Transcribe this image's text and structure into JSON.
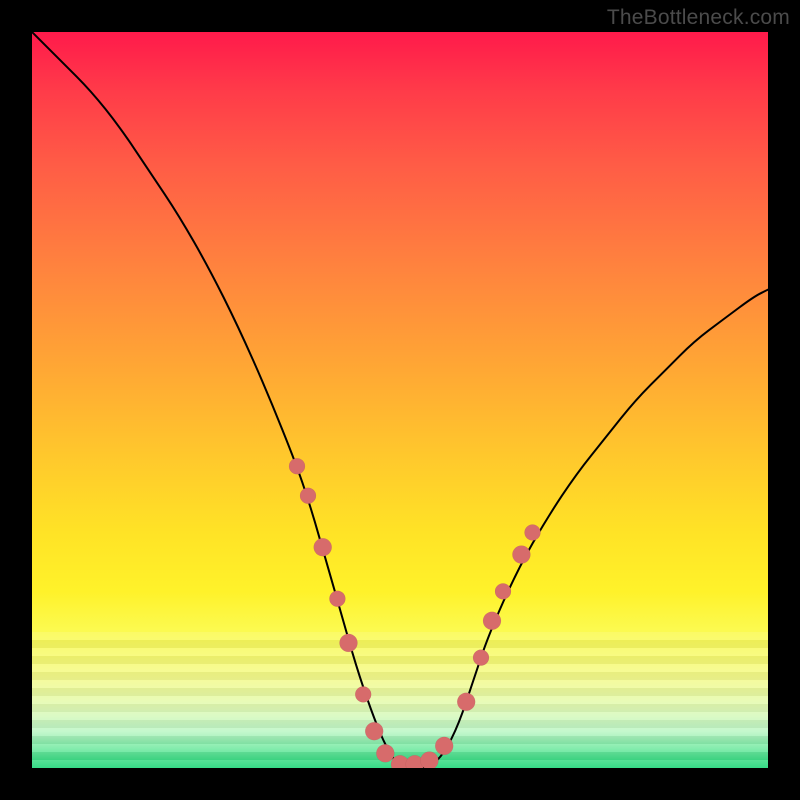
{
  "watermark": "TheBottleneck.com",
  "chart_data": {
    "type": "line",
    "title": "",
    "xlabel": "",
    "ylabel": "",
    "xlim": [
      0,
      100
    ],
    "ylim": [
      0,
      100
    ],
    "grid": false,
    "legend": false,
    "background_gradient": {
      "stops": [
        {
          "pos": 0,
          "color": "#ff1a4b"
        },
        {
          "pos": 18,
          "color": "#ff5c46"
        },
        {
          "pos": 46,
          "color": "#ffa834"
        },
        {
          "pos": 68,
          "color": "#ffe326"
        },
        {
          "pos": 88,
          "color": "#f4fb90"
        },
        {
          "pos": 100,
          "color": "#1cd777"
        }
      ]
    },
    "series": [
      {
        "name": "bottleneck-curve",
        "x": [
          0,
          4,
          8,
          12,
          16,
          20,
          24,
          28,
          32,
          36,
          38,
          40,
          42,
          44,
          46,
          48,
          50,
          52,
          54,
          56,
          58,
          60,
          62,
          66,
          70,
          74,
          78,
          82,
          86,
          90,
          94,
          98,
          100
        ],
        "y": [
          100,
          96,
          92,
          87,
          81,
          75,
          68,
          60,
          51,
          41,
          35,
          28,
          21,
          14,
          8,
          3,
          0,
          0,
          0,
          2,
          6,
          12,
          18,
          27,
          34,
          40,
          45,
          50,
          54,
          58,
          61,
          64,
          65
        ],
        "color": "#000000",
        "width": 2
      }
    ],
    "markers": {
      "name": "highlight-dots",
      "color": "#d76b6b",
      "radius_primary": 9,
      "radius_secondary": 7,
      "points": [
        {
          "x": 36.0,
          "y": 41.0,
          "r": 8
        },
        {
          "x": 37.5,
          "y": 37.0,
          "r": 8
        },
        {
          "x": 39.5,
          "y": 30.0,
          "r": 9
        },
        {
          "x": 41.5,
          "y": 23.0,
          "r": 8
        },
        {
          "x": 43.0,
          "y": 17.0,
          "r": 9
        },
        {
          "x": 45.0,
          "y": 10.0,
          "r": 8
        },
        {
          "x": 46.5,
          "y": 5.0,
          "r": 9
        },
        {
          "x": 48.0,
          "y": 2.0,
          "r": 9
        },
        {
          "x": 50.0,
          "y": 0.5,
          "r": 9
        },
        {
          "x": 52.0,
          "y": 0.5,
          "r": 9
        },
        {
          "x": 54.0,
          "y": 1.0,
          "r": 9
        },
        {
          "x": 56.0,
          "y": 3.0,
          "r": 9
        },
        {
          "x": 59.0,
          "y": 9.0,
          "r": 9
        },
        {
          "x": 61.0,
          "y": 15.0,
          "r": 8
        },
        {
          "x": 62.5,
          "y": 20.0,
          "r": 9
        },
        {
          "x": 64.0,
          "y": 24.0,
          "r": 8
        },
        {
          "x": 66.5,
          "y": 29.0,
          "r": 9
        },
        {
          "x": 68.0,
          "y": 32.0,
          "r": 8
        }
      ]
    }
  }
}
